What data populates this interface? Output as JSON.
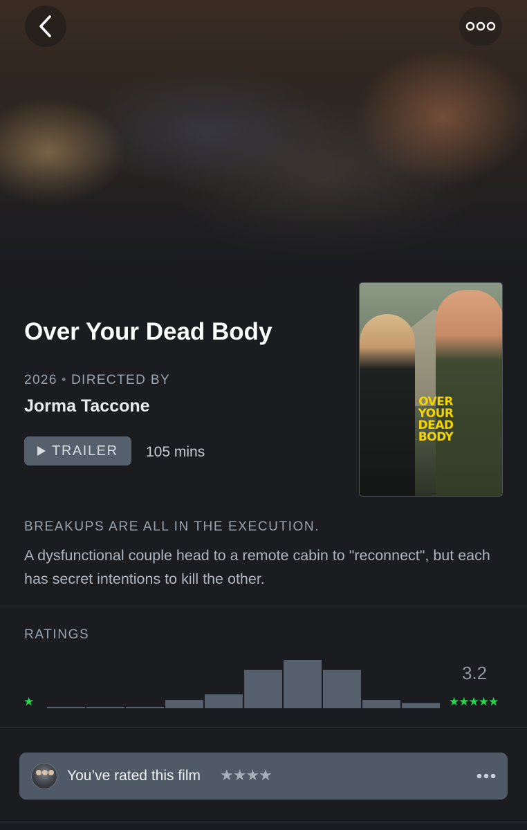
{
  "nav": {
    "back_icon": "chevron-left-icon",
    "more_icon": "ellipsis-icon"
  },
  "film": {
    "title": "Over Your Dead Body",
    "year": "2026",
    "directed_by_label": "DIRECTED BY",
    "director": "Jorma Taccone",
    "trailer_label": "TRAILER",
    "runtime": "105 mins",
    "poster_title": "OVER YOUR DEAD BODY",
    "tagline": "BREAKUPS ARE ALL IN THE EXECUTION.",
    "synopsis": "A dysfunctional couple head to a remote cabin to \"reconnect\", but each has secret intentions to kill the other."
  },
  "ratings": {
    "label": "RATINGS",
    "average": "3.2",
    "min_stars": "★",
    "max_stars": "★★★★★",
    "distribution": [
      0.03,
      0.03,
      0.03,
      0.17,
      0.29,
      0.79,
      1.0,
      0.79,
      0.17,
      0.11
    ],
    "bar_color": "#56606c",
    "star_color": "#29d64f"
  },
  "user_rating": {
    "text": "You’ve rated this film",
    "stars": "★★★★",
    "stars_value": 4,
    "more_icon": "ellipsis-icon"
  },
  "colors": {
    "background": "#1b1c20",
    "accent_green": "#29d64f",
    "muted_text": "#9aa4ae"
  }
}
